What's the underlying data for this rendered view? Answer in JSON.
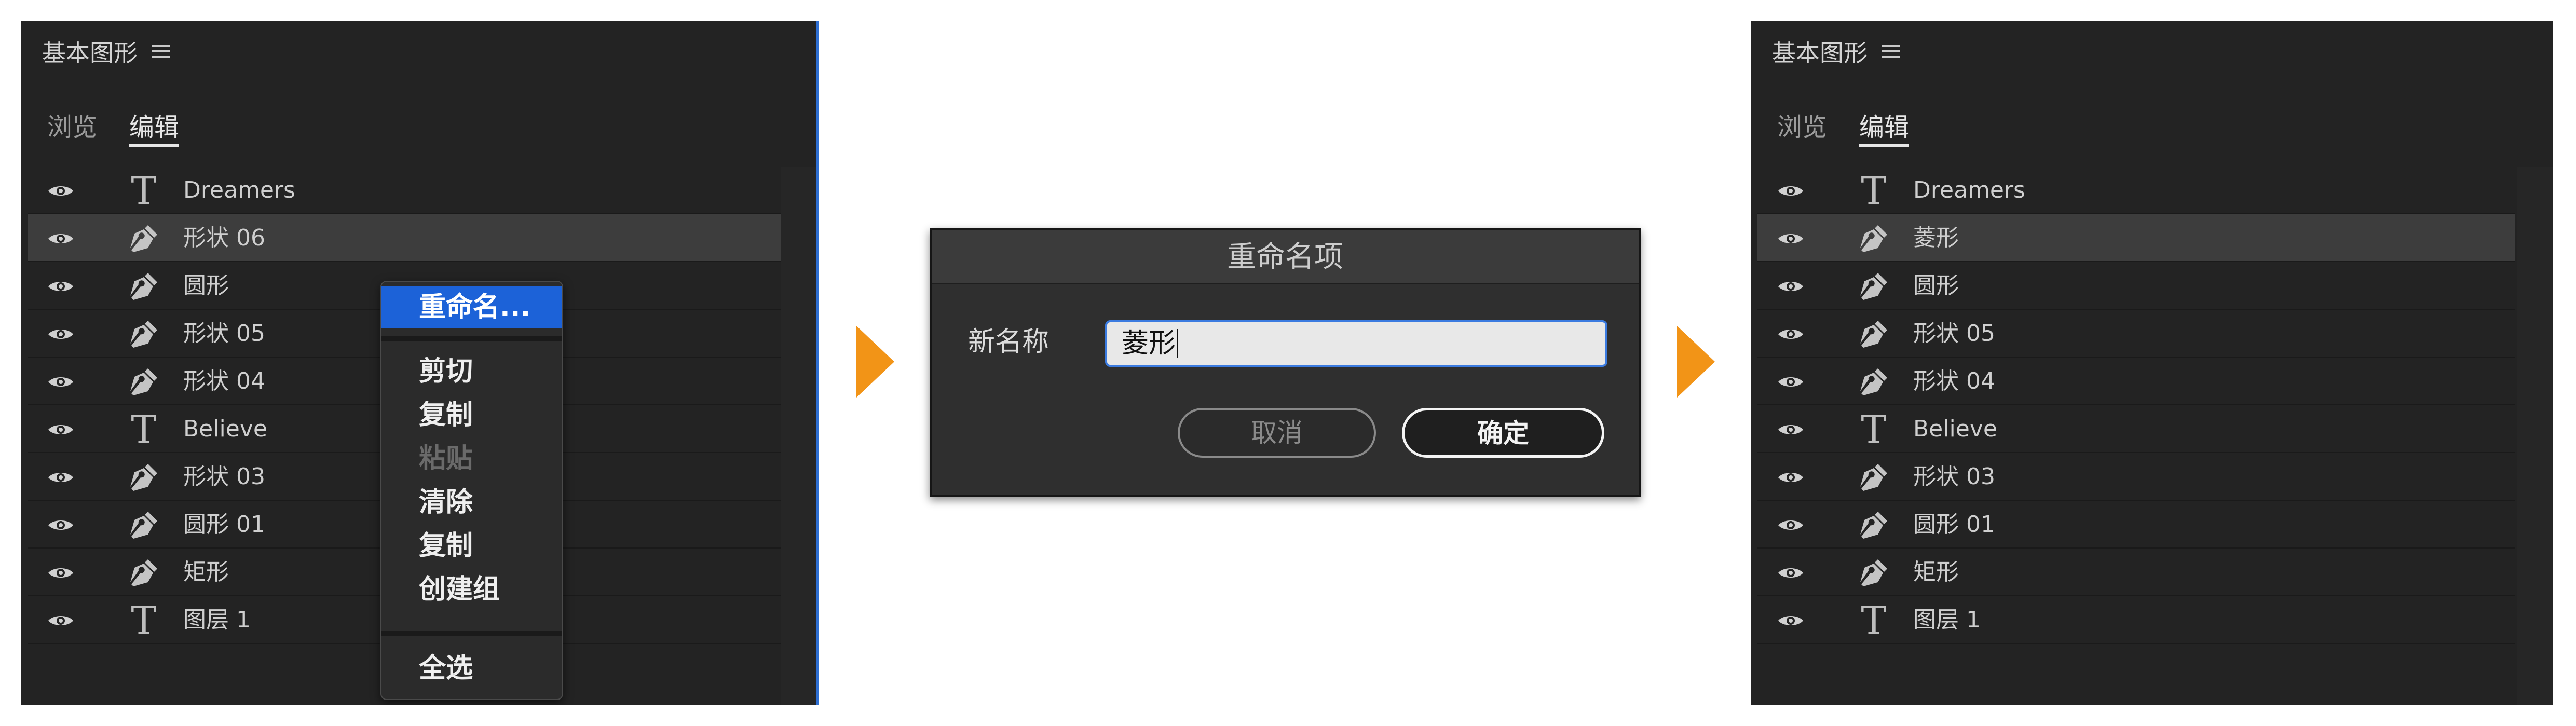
{
  "colors": {
    "accent_arrow": "#f29417",
    "menu_highlight": "#1c62d8",
    "panel_bg": "#232323"
  },
  "left_panel": {
    "title": "基本图形",
    "tabs": [
      "浏览",
      "编辑"
    ],
    "active_tab": "编辑",
    "layers": [
      {
        "label": "Dreamers",
        "icon": "text-t-icon"
      },
      {
        "label": "形状 06",
        "icon": "pen-icon",
        "selected": true
      },
      {
        "label": "圆形",
        "icon": "pen-icon"
      },
      {
        "label": "形状 05",
        "icon": "pen-icon"
      },
      {
        "label": "形状 04",
        "icon": "pen-icon"
      },
      {
        "label": "Believe",
        "icon": "text-t-icon"
      },
      {
        "label": "形状 03",
        "icon": "pen-icon"
      },
      {
        "label": "圆形 01",
        "icon": "pen-icon"
      },
      {
        "label": "矩形",
        "icon": "pen-icon"
      },
      {
        "label": "图层 1",
        "icon": "text-t-icon"
      }
    ]
  },
  "context_menu": {
    "items": [
      {
        "label": "重命名...",
        "highlighted": true
      },
      {
        "label": "剪切"
      },
      {
        "label": "复制"
      },
      {
        "label": "粘贴",
        "disabled": true
      },
      {
        "label": "清除"
      },
      {
        "label": "复制"
      },
      {
        "label": "创建组"
      },
      {
        "label": "全选"
      }
    ]
  },
  "dialog": {
    "title": "重命名项",
    "field_label": "新名称",
    "field_value": "菱形",
    "cancel_label": "取消",
    "ok_label": "确定"
  },
  "right_panel": {
    "title": "基本图形",
    "tabs": [
      "浏览",
      "编辑"
    ],
    "active_tab": "编辑",
    "layers": [
      {
        "label": "Dreamers",
        "icon": "text-t-icon"
      },
      {
        "label": "菱形",
        "icon": "pen-icon",
        "selected": true
      },
      {
        "label": "圆形",
        "icon": "pen-icon"
      },
      {
        "label": "形状 05",
        "icon": "pen-icon"
      },
      {
        "label": "形状 04",
        "icon": "pen-icon"
      },
      {
        "label": "Believe",
        "icon": "text-t-icon"
      },
      {
        "label": "形状 03",
        "icon": "pen-icon"
      },
      {
        "label": "圆形 01",
        "icon": "pen-icon"
      },
      {
        "label": "矩形",
        "icon": "pen-icon"
      },
      {
        "label": "图层 1",
        "icon": "text-t-icon"
      }
    ]
  }
}
